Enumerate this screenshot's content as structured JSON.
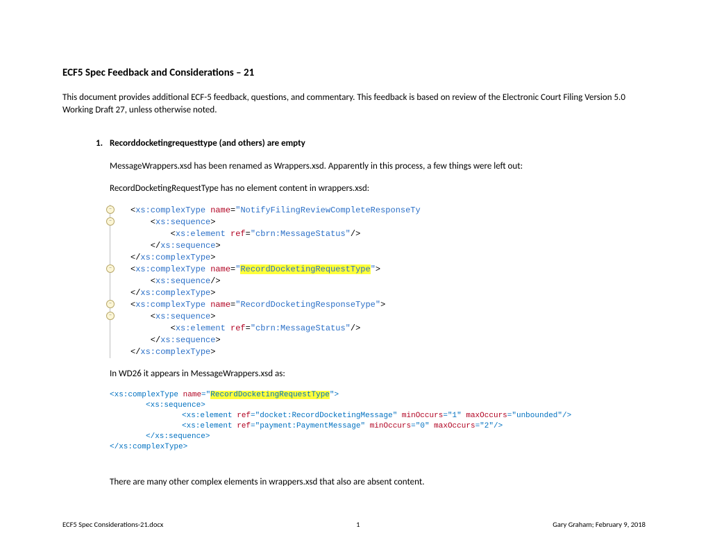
{
  "title": "ECF5 Spec Feedback and Considerations – 21",
  "intro": "This document provides additional ECF-5 feedback, questions, and commentary. This feedback is based on review of the Electronic Court Filing Version 5.0 Working Draft 27, unless otherwise noted.",
  "section": {
    "num": "1.",
    "heading": "Recorddocketingrequesttype (and others) are empty"
  },
  "p1": "MessageWrappers.xsd has been renamed as Wrappers.xsd. Apparently in this process, a few things were left out:",
  "p2": "RecordDocketingRequestType has no element content in wrappers.xsd:",
  "code1": {
    "name1": "NotifyFilingReviewCompleteResponseTy",
    "ref1": "cbrn:MessageStatus",
    "name2": "RecordDocketingRequestType",
    "name3": "RecordDocketingResponseType",
    "ref2": "cbrn:MessageStatus",
    "tags": {
      "ct_open": "xs:complexType",
      "ct_close": "xs:complexType",
      "seq_open": "xs:sequence",
      "seq_close": "xs:sequence",
      "seq_empty": "xs:sequence",
      "el": "xs:element",
      "attr_name": "name",
      "attr_ref": "ref"
    }
  },
  "p3": "In WD26 it appears in MessageWrappers.xsd as:",
  "code2": {
    "name": "RecordDocketingRequestType",
    "el1_ref": "docket:RecordDocketingMessage",
    "el1_min": "1",
    "el1_max": "unbounded",
    "el2_ref": "payment:PaymentMessage",
    "el2_min": "0",
    "el2_max": "2",
    "tags": {
      "ct": "xs:complexType",
      "seq": "xs:sequence",
      "el": "xs:element",
      "attr_name": "name",
      "attr_ref": "ref",
      "attr_min": "minOccurs",
      "attr_max": "maxOccurs"
    }
  },
  "p4": "There are many other complex elements in wrappers.xsd that also are absent content.",
  "footer": {
    "left": "ECF5 Spec Considerations-21.docx",
    "center": "1",
    "right": "Gary Graham; February 9, 2018"
  }
}
